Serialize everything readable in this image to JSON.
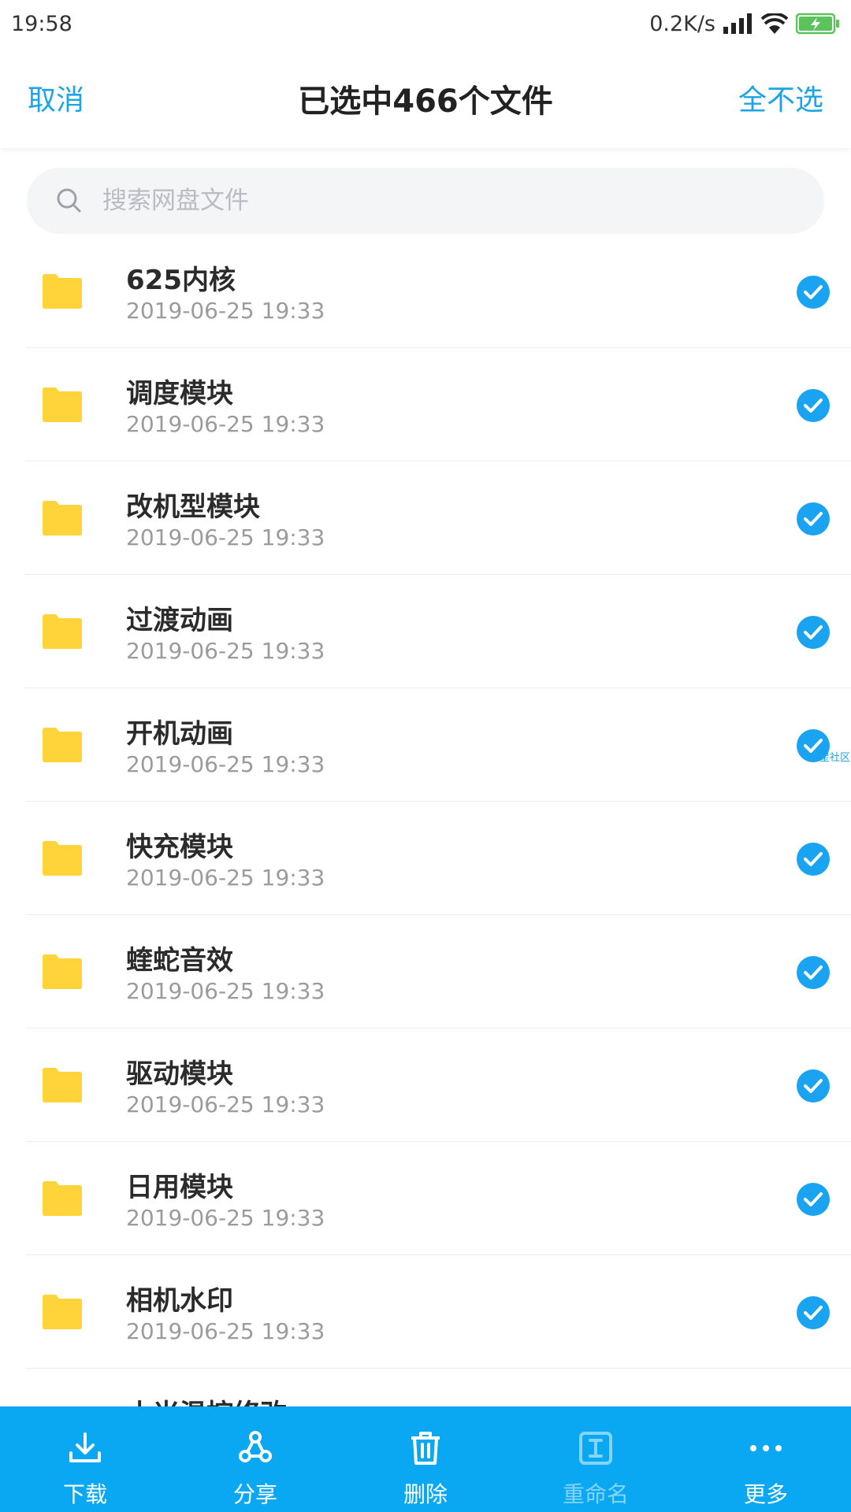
{
  "status_bar": {
    "time": "19:58",
    "network_speed": "0.2K/s"
  },
  "header": {
    "cancel_label": "取消",
    "title": "已选中466个文件",
    "deselect_all_label": "全不选"
  },
  "search": {
    "placeholder": "搜索网盘文件"
  },
  "files": [
    {
      "name": "625内核",
      "date": "2019-06-25  19:33",
      "selected": true
    },
    {
      "name": "调度模块",
      "date": "2019-06-25  19:33",
      "selected": true
    },
    {
      "name": "改机型模块",
      "date": "2019-06-25  19:33",
      "selected": true
    },
    {
      "name": "过渡动画",
      "date": "2019-06-25  19:33",
      "selected": true
    },
    {
      "name": "开机动画",
      "date": "2019-06-25  19:33",
      "selected": true
    },
    {
      "name": "快充模块",
      "date": "2019-06-25  19:33",
      "selected": true
    },
    {
      "name": "蝰蛇音效",
      "date": "2019-06-25  19:33",
      "selected": true
    },
    {
      "name": "驱动模块",
      "date": "2019-06-25  19:33",
      "selected": true
    },
    {
      "name": "日用模块",
      "date": "2019-06-25  19:33",
      "selected": true
    },
    {
      "name": "相机水印",
      "date": "2019-06-25  19:33",
      "selected": true
    },
    {
      "name": "小米温控修改",
      "date": "",
      "selected": true
    }
  ],
  "watermark": "星社区",
  "bottom_bar": {
    "download_label": "下载",
    "share_label": "分享",
    "delete_label": "删除",
    "rename_label": "重命名",
    "more_label": "更多"
  },
  "colors": {
    "accent": "#1ba4e8",
    "bottom_bar": "#0aa8f2",
    "folder": "#ffd43b",
    "check": "#1aa3f0"
  }
}
